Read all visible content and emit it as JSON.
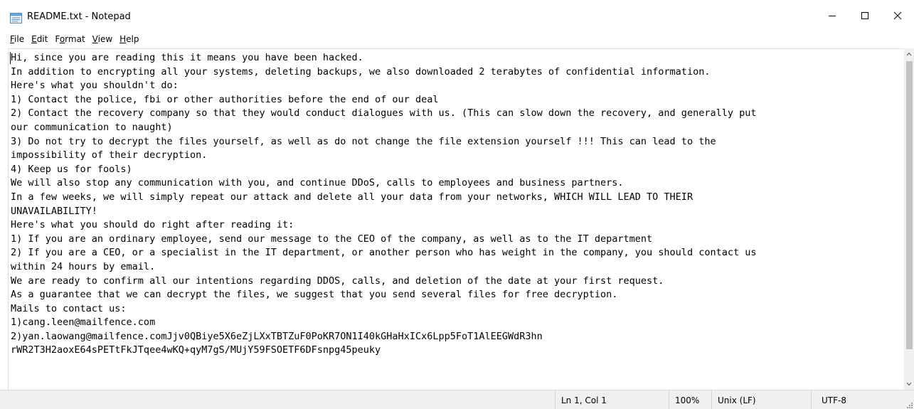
{
  "window": {
    "title": "README.txt - Notepad",
    "app_icon": "notepad-icon",
    "controls": {
      "minimize": "minimize-icon",
      "maximize": "maximize-icon",
      "close": "close-icon"
    }
  },
  "menu": [
    {
      "id": "file",
      "key": "F",
      "rest": "ile"
    },
    {
      "id": "edit",
      "key": "E",
      "rest": "dit"
    },
    {
      "id": "format",
      "pre": "F",
      "key": "o",
      "rest": "rmat"
    },
    {
      "id": "view",
      "key": "V",
      "rest": "iew"
    },
    {
      "id": "help",
      "key": "H",
      "rest": "elp"
    }
  ],
  "document": {
    "lines": [
      "Hi, since you are reading this it means you have been hacked.",
      "In addition to encrypting all your systems, deleting backups, we also downloaded 2 terabytes of confidential information.",
      "Here's what you shouldn't do:",
      "1) Contact the police, fbi or other authorities before the end of our deal",
      "2) Contact the recovery company so that they would conduct dialogues with us. (This can slow down the recovery, and generally put",
      "our communication to naught)",
      "3) Do not try to decrypt the files yourself, as well as do not change the file extension yourself !!! This can lead to the",
      "impossibility of their decryption.",
      "4) Keep us for fools)",
      "We will also stop any communication with you, and continue DDoS, calls to employees and business partners.",
      "In a few weeks, we will simply repeat our attack and delete all your data from your networks, WHICH WILL LEAD TO THEIR",
      "UNAVAILABILITY!",
      "Here's what you should do right after reading it:",
      "1) If you are an ordinary employee, send our message to the CEO of the company, as well as to the IT department",
      "2) If you are a CEO, or a specialist in the IT department, or another person who has weight in the company, you should contact us",
      "within 24 hours by email.",
      "We are ready to confirm all our intentions regarding DDOS, calls, and deletion of the date at your first request.",
      "As a guarantee that we can decrypt the files, we suggest that you send several files for free decryption.",
      "Mails to contact us:",
      "1)cang.leen@mailfence.com",
      "2)yan.laowang@mailfence.comJjv0QBiye5X6eZjLXxTBTZuF0PoKR7ON1I40kGHaHxICx6Lpp5FoT1AlEEGWdR3hn",
      "rWR2T3H2aoxE64sPETtFkJTqee4wKQ+qyM7gS/MUjY59FSOETF6DFsnpg45peuky"
    ]
  },
  "statusbar": {
    "position": "Ln 1, Col 1",
    "zoom": "100%",
    "line_ending": "Unix (LF)",
    "encoding": "UTF-8"
  }
}
